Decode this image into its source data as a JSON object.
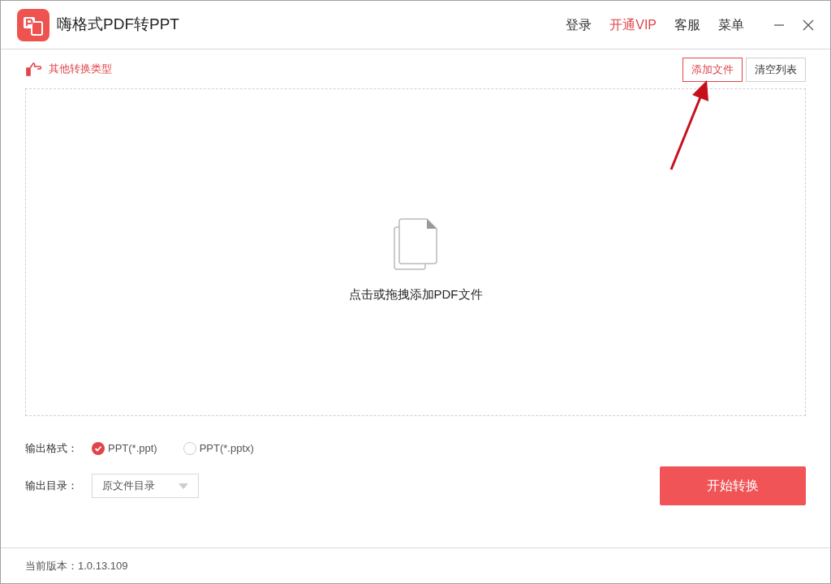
{
  "window": {
    "title": "嗨格式PDF转PPT"
  },
  "nav": [
    {
      "label": "登录",
      "highlighted": false
    },
    {
      "label": "开通VIP",
      "highlighted": true
    },
    {
      "label": "客服",
      "highlighted": false
    },
    {
      "label": "菜单",
      "highlighted": false
    }
  ],
  "toolbar": {
    "other_types": "其他转换类型",
    "buttons": [
      {
        "label": "添加文件",
        "highlighted": true
      },
      {
        "label": "清空列表",
        "highlighted": false
      }
    ]
  },
  "drop_zone": {
    "hint": "点击或拖拽添加PDF文件"
  },
  "output_format": {
    "label": "输出格式：",
    "options": [
      {
        "label": "PPT(*.ppt)",
        "selected": true
      },
      {
        "label": "PPT(*.pptx)",
        "selected": false
      }
    ]
  },
  "output_dir": {
    "label": "输出目录：",
    "value": "原文件目录"
  },
  "start_button": "开始转换",
  "status_bar": {
    "version": "当前版本：1.0.13.109"
  }
}
